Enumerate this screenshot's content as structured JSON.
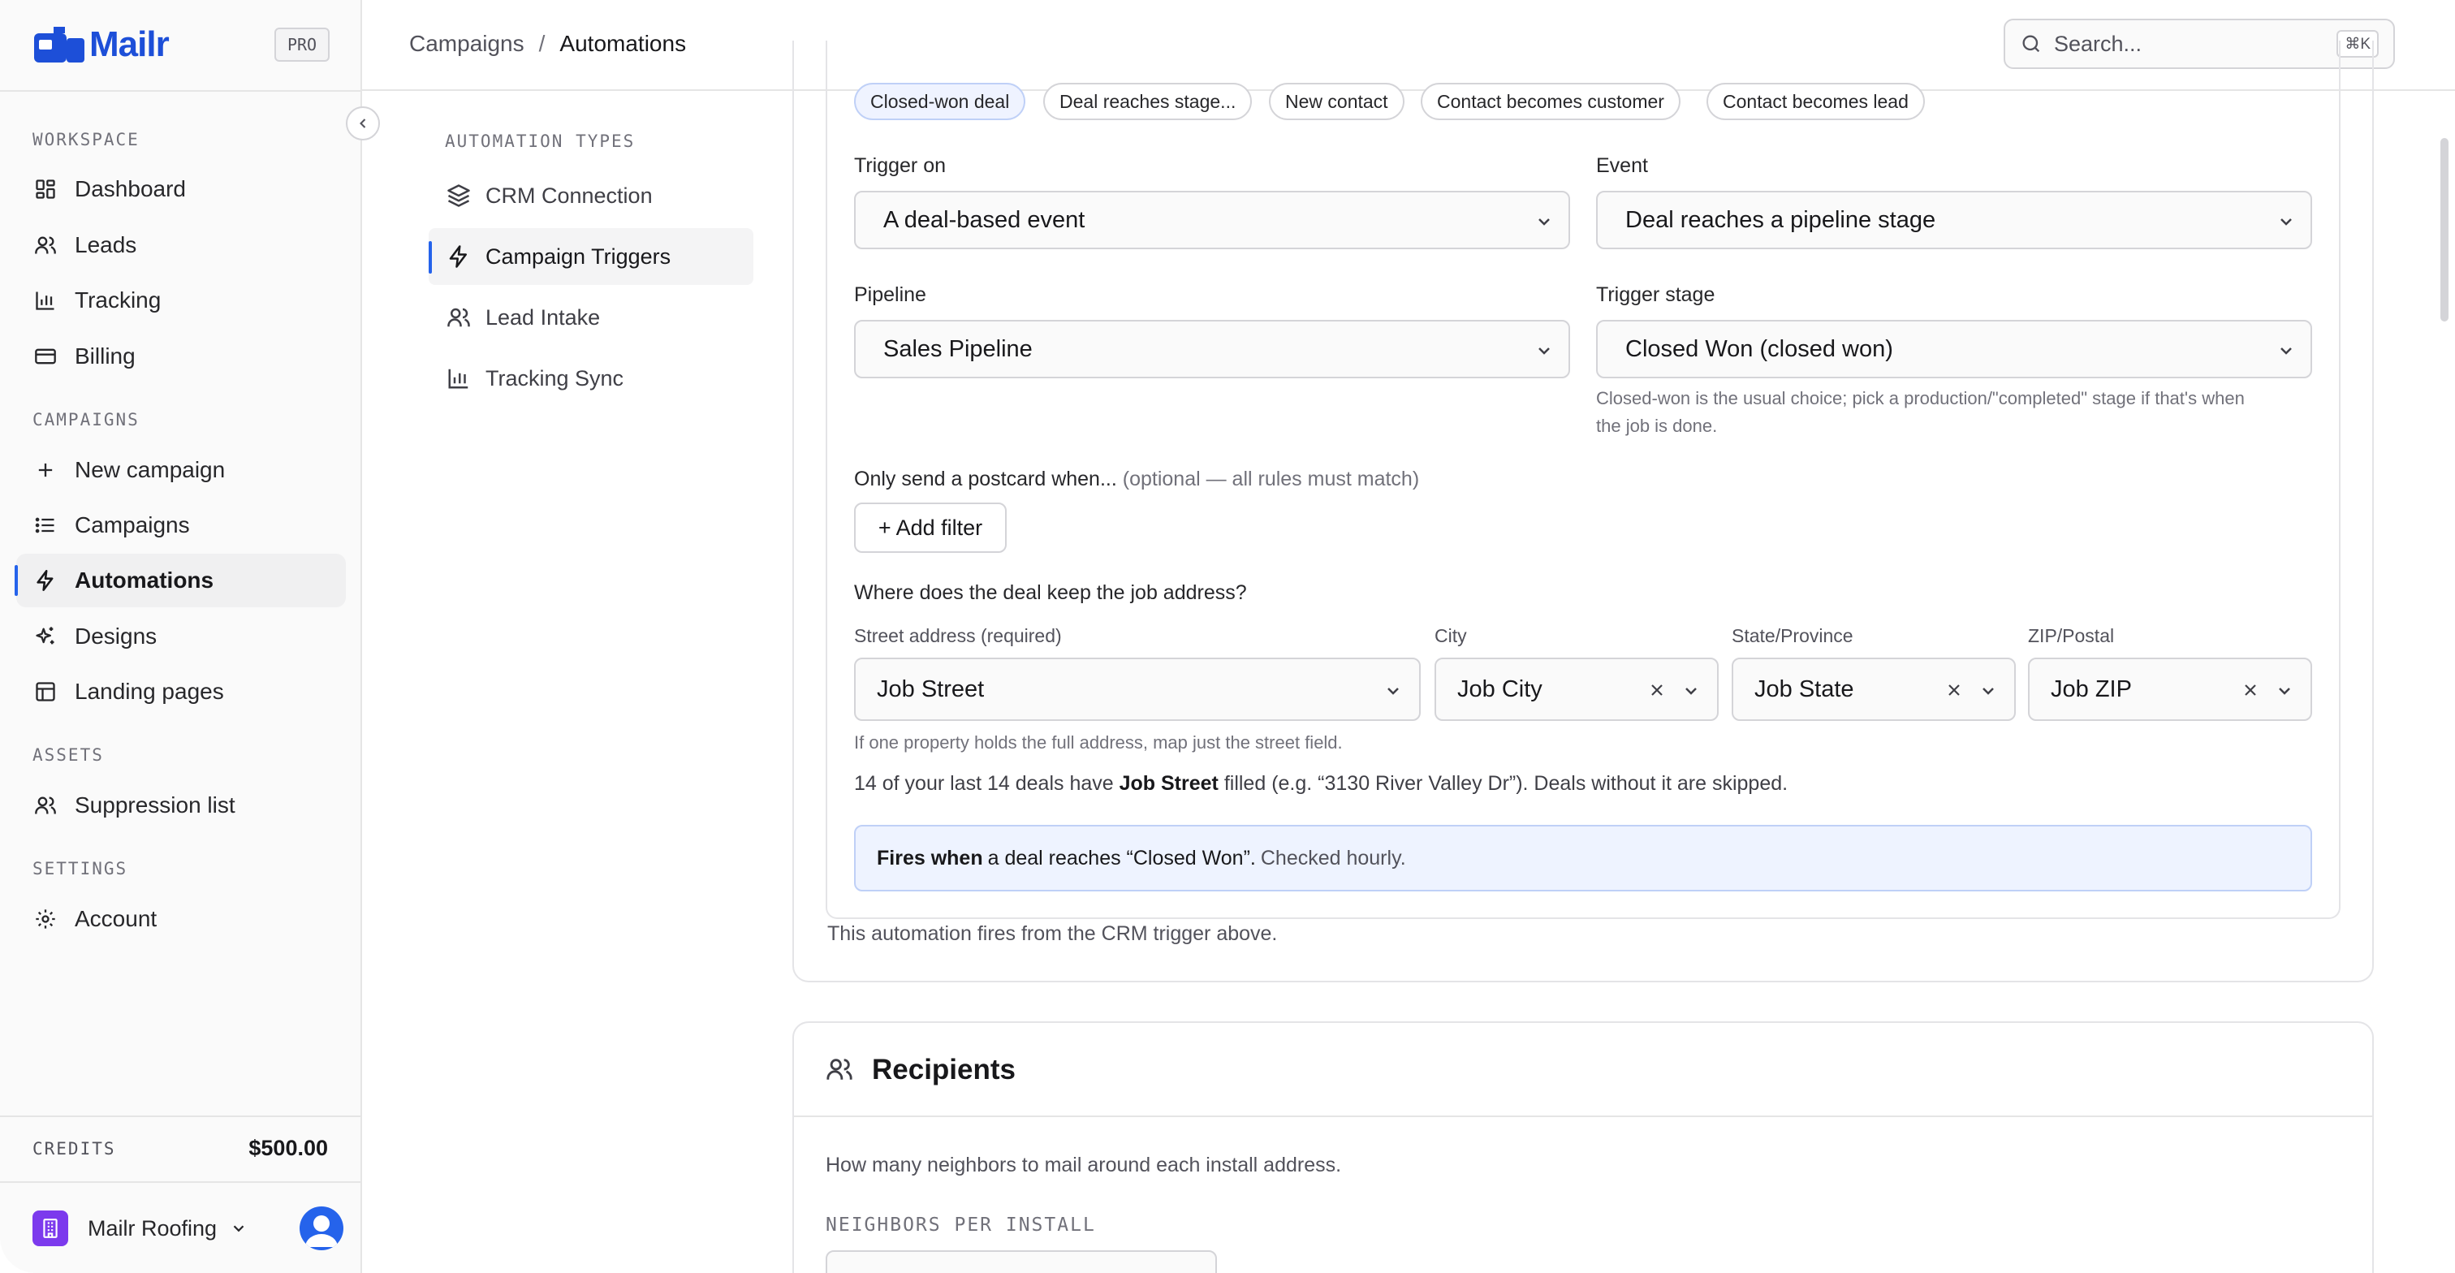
{
  "app": {
    "name": "Mailr",
    "plan_badge": "PRO",
    "brand_color": "#1d4fd8",
    "accent_color": "#2563eb"
  },
  "sidebar": {
    "sections": [
      {
        "label": "WORKSPACE",
        "items": [
          {
            "label": "Dashboard",
            "icon": "dashboard-icon"
          },
          {
            "label": "Leads",
            "icon": "users-icon"
          },
          {
            "label": "Tracking",
            "icon": "bar-chart-icon"
          },
          {
            "label": "Billing",
            "icon": "credit-card-icon"
          }
        ]
      },
      {
        "label": "CAMPAIGNS",
        "items": [
          {
            "label": "New campaign",
            "icon": "plus-icon"
          },
          {
            "label": "Campaigns",
            "icon": "list-icon"
          },
          {
            "label": "Automations",
            "icon": "lightning-icon",
            "active": true
          },
          {
            "label": "Designs",
            "icon": "sparkles-icon"
          },
          {
            "label": "Landing pages",
            "icon": "layout-icon"
          }
        ]
      },
      {
        "label": "ASSETS",
        "items": [
          {
            "label": "Suppression list",
            "icon": "users-icon"
          }
        ]
      },
      {
        "label": "SETTINGS",
        "items": [
          {
            "label": "Account",
            "icon": "gear-icon"
          }
        ]
      }
    ],
    "credits_label": "CREDITS",
    "credits_value": "$500.00",
    "org_name": "Mailr Roofing"
  },
  "topbar": {
    "breadcrumb": [
      "Campaigns",
      "Automations"
    ],
    "search_placeholder": "Search...",
    "search_shortcut": "⌘K"
  },
  "subnav": {
    "label": "AUTOMATION TYPES",
    "items": [
      {
        "label": "CRM Connection",
        "icon": "layers-icon"
      },
      {
        "label": "Campaign Triggers",
        "icon": "lightning-icon",
        "active": true
      },
      {
        "label": "Lead Intake",
        "icon": "users-icon"
      },
      {
        "label": "Tracking Sync",
        "icon": "bar-chart-icon"
      }
    ]
  },
  "trigger": {
    "presets": [
      "Closed-won deal",
      "Deal reaches stage...",
      "New contact",
      "Contact becomes customer",
      "Contact becomes lead"
    ],
    "selected_preset": "Closed-won deal",
    "trigger_on_label": "Trigger on",
    "trigger_on_value": "A deal-based event",
    "event_label": "Event",
    "event_value": "Deal reaches a pipeline stage",
    "pipeline_label": "Pipeline",
    "pipeline_value": "Sales Pipeline",
    "stage_label": "Trigger stage",
    "stage_value": "Closed Won (closed won)",
    "stage_hint_1": "Closed-won is the usual choice; pick a production/\"completed\" stage if that's when",
    "stage_hint_2": "the job is done.",
    "filter_label": "Only send a postcard when...",
    "filter_optional": "(optional — all rules must match)",
    "add_filter_button": "+ Add filter",
    "address_question": "Where does the deal keep the job address?",
    "address_fields": [
      {
        "label": "Street address (required)",
        "value": "Job Street",
        "clearable": false
      },
      {
        "label": "City",
        "value": "Job City",
        "clearable": true
      },
      {
        "label": "State/Province",
        "value": "Job State",
        "clearable": true
      },
      {
        "label": "ZIP/Postal",
        "value": "Job ZIP",
        "clearable": true
      }
    ],
    "address_hint": "If one property holds the full address, map just the street field.",
    "coverage_prefix": "14 of your last 14 deals have",
    "coverage_field": "Job Street",
    "coverage_suffix": "filled (e.g. “3130 River Valley Dr”). Deals without it are skipped.",
    "fires_bold": "Fires when",
    "fires_text": "a deal reaches “Closed Won”.",
    "fires_muted": "Checked hourly.",
    "footnote": "This automation fires from the CRM trigger above."
  },
  "recipients": {
    "title": "Recipients",
    "description": "How many neighbors to mail around each install address.",
    "neighbors_label": "NEIGHBORS PER INSTALL"
  }
}
